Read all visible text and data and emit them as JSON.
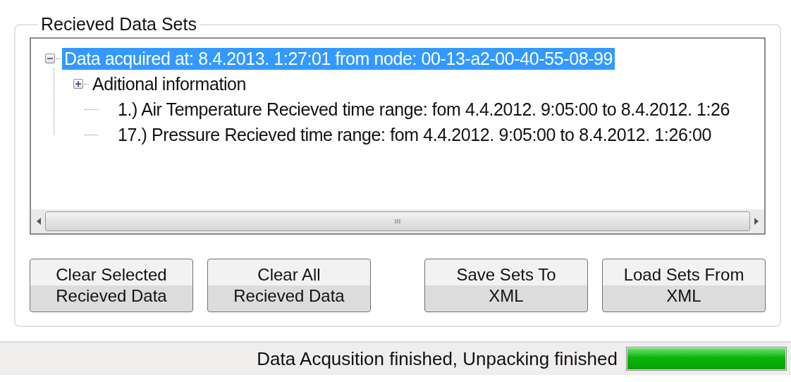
{
  "group": {
    "title": "Recieved Data Sets"
  },
  "tree": [
    {
      "label": "Data acquired at: 8.4.2013. 1:27:01  from node: 00-13-a2-00-40-55-08-99",
      "selected": true,
      "expanded": true,
      "children": [
        {
          "label": "Aditional information",
          "selected": false,
          "expanded": false
        },
        {
          "label": "1.) Air Temperature Recieved time range: fom 4.4.2012. 9:05:00 to 8.4.2012. 1:26",
          "selected": false
        },
        {
          "label": "17.) Pressure Recieved time range: fom 4.4.2012. 9:05:00 to 8.4.2012. 1:26:00",
          "selected": false
        }
      ]
    }
  ],
  "buttons": [
    {
      "lines": [
        "Clear Selected",
        "Recieved Data"
      ]
    },
    {
      "lines": [
        "Clear All",
        "Recieved Data"
      ]
    },
    {
      "lines": [
        "Save Sets To",
        "XML"
      ]
    },
    {
      "lines": [
        "Load Sets From",
        "XML"
      ]
    }
  ],
  "status_bar": {
    "text": "Data Acqusition finished, Unpacking finished",
    "level": 1
  }
}
